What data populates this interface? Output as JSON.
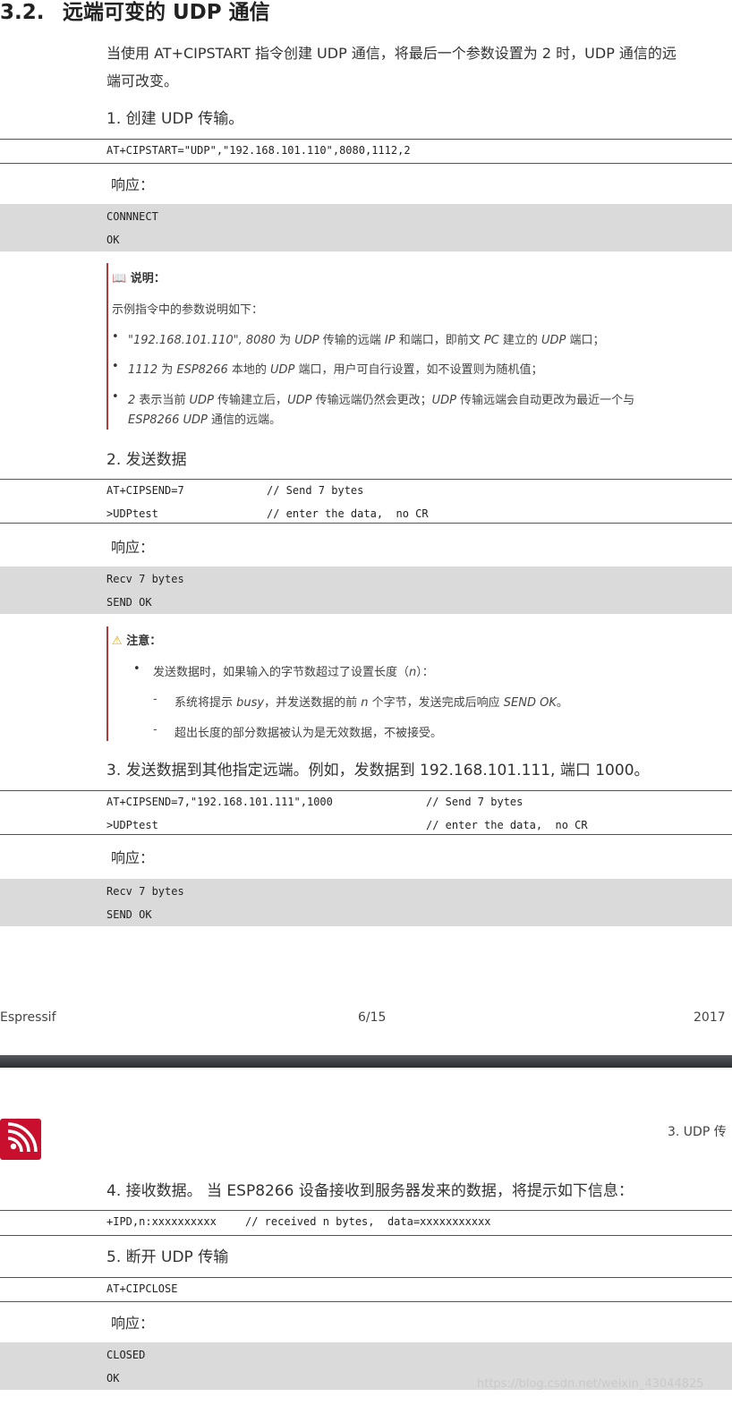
{
  "section": {
    "number": "3.2.",
    "title": "远端可变的 UDP 通信",
    "intro_line1": "当使用 AT+CIPSTART 指令创建 UDP 通信，将最后一个参数设置为 2 时，UDP 通信的远",
    "intro_line2": "端可改变。"
  },
  "steps": {
    "s1": "1. 创建 UDP 传输。",
    "s2": "2. 发送数据",
    "s3": "3. 发送数据到其他指定远端。例如，发数据到 192.168.101.111, 端口 1000。",
    "s4": "4. 接收数据。 当 ESP8266 设备接收到服务器发来的数据，将提示如下信息：",
    "s5": "5. 断开 UDP 传输"
  },
  "response_label": "响应：",
  "code": {
    "c1_line1": "AT+CIPSTART=\"UDP\",\"192.168.101.110\",8080,1112,2",
    "r1_line1": "CONNNECT",
    "r1_line2": "OK",
    "c2_line1_cmd": "AT+CIPSEND=7",
    "c2_line1_cmt": "// Send 7 bytes",
    "c2_line2_cmd": ">UDPtest",
    "c2_line2_cmt": "// enter the data,  no CR",
    "r2_line1": "Recv 7 bytes",
    "r2_line2": "SEND OK",
    "c3_line1_cmd": "AT+CIPSEND=7,\"192.168.101.111\",1000",
    "c3_line1_cmt": "// Send 7 bytes",
    "c3_line2_cmd": ">UDPtest",
    "c3_line2_cmt": "// enter the data,  no CR",
    "r3_line1": "Recv 7 bytes",
    "r3_line2": "SEND OK",
    "c4_line1_cmd": "+IPD,n:xxxxxxxxxx",
    "c4_line1_cmt": "// received n bytes,  data=xxxxxxxxxxx",
    "c5_line1": "AT+CIPCLOSE",
    "r5_line1": "CLOSED",
    "r5_line2": "OK"
  },
  "note": {
    "title": "说明：",
    "intro": "示例指令中的参数说明如下：",
    "b1_italic": "\"192.168.101.110\", 8080",
    "b1_a": " 为 ",
    "b1_b": "UDP",
    "b1_c": " 传输的远端 ",
    "b1_d": "IP",
    "b1_e": " 和端口，即前文 ",
    "b1_f": "PC",
    "b1_g": " 建立的 ",
    "b1_h": "UDP",
    "b1_i": " 端口；",
    "b2_a": "1112",
    "b2_b": " 为 ",
    "b2_c": "ESP8266",
    "b2_d": " 本地的 ",
    "b2_e": "UDP",
    "b2_f": " 端口，用户可自行设置，如不设置则为随机值；",
    "b3_a": "2",
    "b3_b": " 表示当前 ",
    "b3_c": "UDP",
    "b3_d": " 传输建立后，",
    "b3_e": "UDP",
    "b3_f": " 传输远端仍然会更改；",
    "b3_g": "UDP",
    "b3_h": " 传输远端会自动更改为最近一个与",
    "b3_line2_a": "ESP8266 UDP",
    "b3_line2_b": " 通信的远端。"
  },
  "attention": {
    "title": "注意：",
    "b1_a": "发送数据时，如果输入的字节数超过了设置长度（",
    "b1_n": "n",
    "b1_b": "）：",
    "d1_a": "系统将提示 ",
    "d1_busy": "busy",
    "d1_b": "，并发送数据的前 ",
    "d1_n": "n",
    "d1_c": " 个字节，发送完成后响应 ",
    "d1_ok": "SEND OK",
    "d1_d": "。",
    "d2": "超出长度的部分数据被认为是无效数据，不被接受。"
  },
  "footer": {
    "company": "Espressif",
    "page": "6/15",
    "year": "2017"
  },
  "next_page_header": "3. UDP 传",
  "watermark": "https://blog.csdn.net/weixin_43044825"
}
